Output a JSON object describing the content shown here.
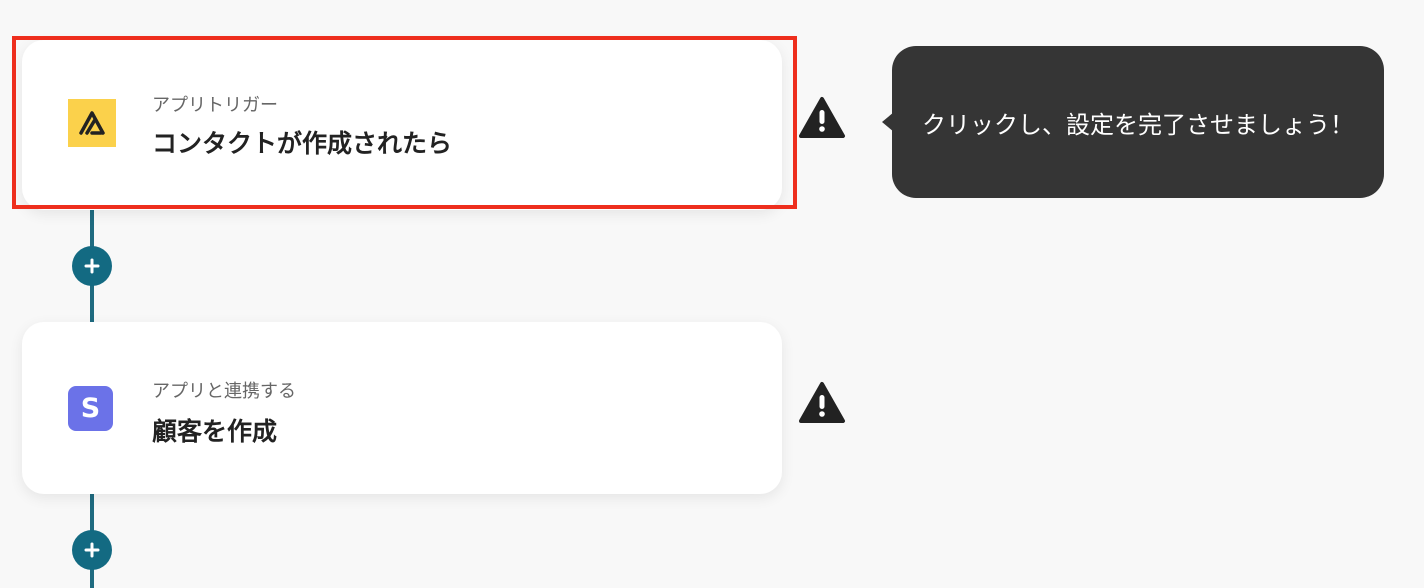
{
  "steps": [
    {
      "subtitle": "アプリトリガー",
      "title": "コンタクトが作成されたら",
      "icon": "triangle-app-logo-icon",
      "color": "#fbd14b"
    },
    {
      "subtitle": "アプリと連携する",
      "title": "顧客を作成",
      "icon": "stripe-s-logo-icon",
      "icon_letter": "S",
      "color": "#6b72e8"
    }
  ],
  "tooltip": {
    "text": "クリックし、設定を完了させましょう！"
  },
  "colors": {
    "connector": "#1f6b80",
    "plus_button": "#136a82",
    "highlight": "#ee2e1d",
    "warning": "#222222"
  }
}
